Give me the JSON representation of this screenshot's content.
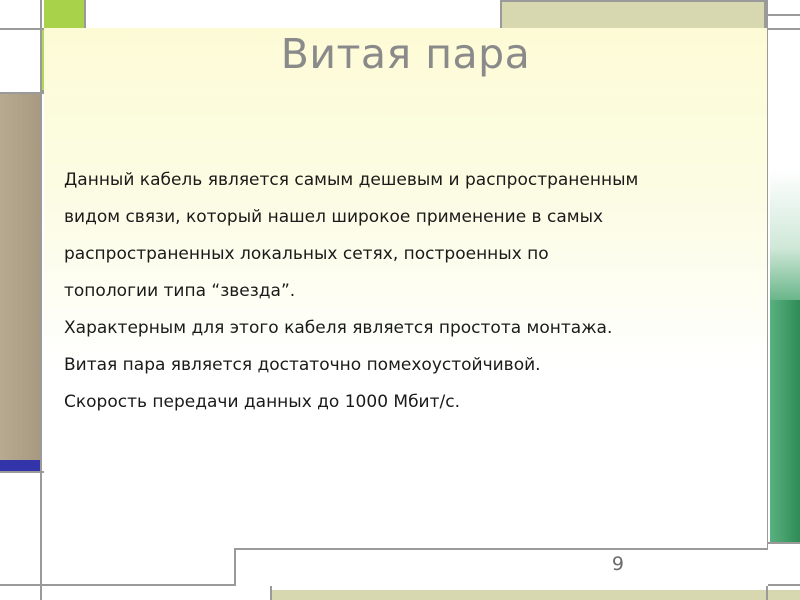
{
  "slide": {
    "title": "Витая пара",
    "paragraphs": [
      "Данный кабель является самым дешевым и распространенным",
      "видом связи, который нашел широкое применение в самых",
      "распространенных локальных сетях, построенных по",
      "топологии типа “звезда”.",
      "Характерным для этого кабеля является простота монтажа.",
      "Витая пара является достаточно помехоустойчивой.",
      "Скорость передачи данных до 1000 Мбит/с."
    ],
    "page_number": "9"
  },
  "colors": {
    "lime": "#a8d24a",
    "tan": "#b5a68c",
    "khaki": "#d8d8b0",
    "green": "#3b9a63",
    "blue": "#3333aa",
    "title": "#8a8a8a"
  }
}
